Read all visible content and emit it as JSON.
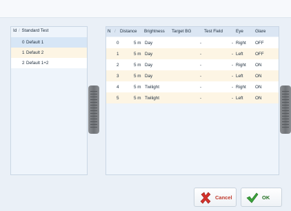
{
  "left_table": {
    "headers": [
      "Id",
      "Standard Test"
    ],
    "rows": [
      {
        "id": "0",
        "name": "Default 1",
        "selected": true
      },
      {
        "id": "1",
        "name": "Default 2",
        "selected": false
      },
      {
        "id": "2",
        "name": "Default 1+2",
        "selected": false
      }
    ]
  },
  "right_table": {
    "headers": [
      "N",
      "Distance",
      "Brightness",
      "Target BG",
      "Test Field",
      "Eye",
      "Glare"
    ],
    "rows": [
      {
        "n": "0",
        "distance": "5 m",
        "brightness": "Day",
        "target_bg": "-",
        "test_field": "-",
        "eye": "Right",
        "glare": "OFF"
      },
      {
        "n": "1",
        "distance": "5 m",
        "brightness": "Day",
        "target_bg": "-",
        "test_field": "-",
        "eye": "Left",
        "glare": "OFF"
      },
      {
        "n": "2",
        "distance": "5 m",
        "brightness": "Day",
        "target_bg": "-",
        "test_field": "-",
        "eye": "Right",
        "glare": "ON"
      },
      {
        "n": "3",
        "distance": "5 m",
        "brightness": "Day",
        "target_bg": "-",
        "test_field": "-",
        "eye": "Left",
        "glare": "ON"
      },
      {
        "n": "4",
        "distance": "5 m",
        "brightness": "Twilight",
        "target_bg": "-",
        "test_field": "-",
        "eye": "Right",
        "glare": "ON"
      },
      {
        "n": "5",
        "distance": "5 m",
        "brightness": "Twilight",
        "target_bg": "-",
        "test_field": "-",
        "eye": "Left",
        "glare": "ON"
      }
    ]
  },
  "buttons": {
    "cancel_label": "Cancel",
    "ok_label": "OK",
    "cancel_icon": "red-x-icon",
    "ok_icon": "green-check-icon"
  },
  "colors": {
    "row_white": "#ffffff",
    "row_cream": "#fdf5e4",
    "row_selected": "#d7e6f6",
    "cancel_text": "#c0392b",
    "ok_text": "#1f6e1f"
  }
}
